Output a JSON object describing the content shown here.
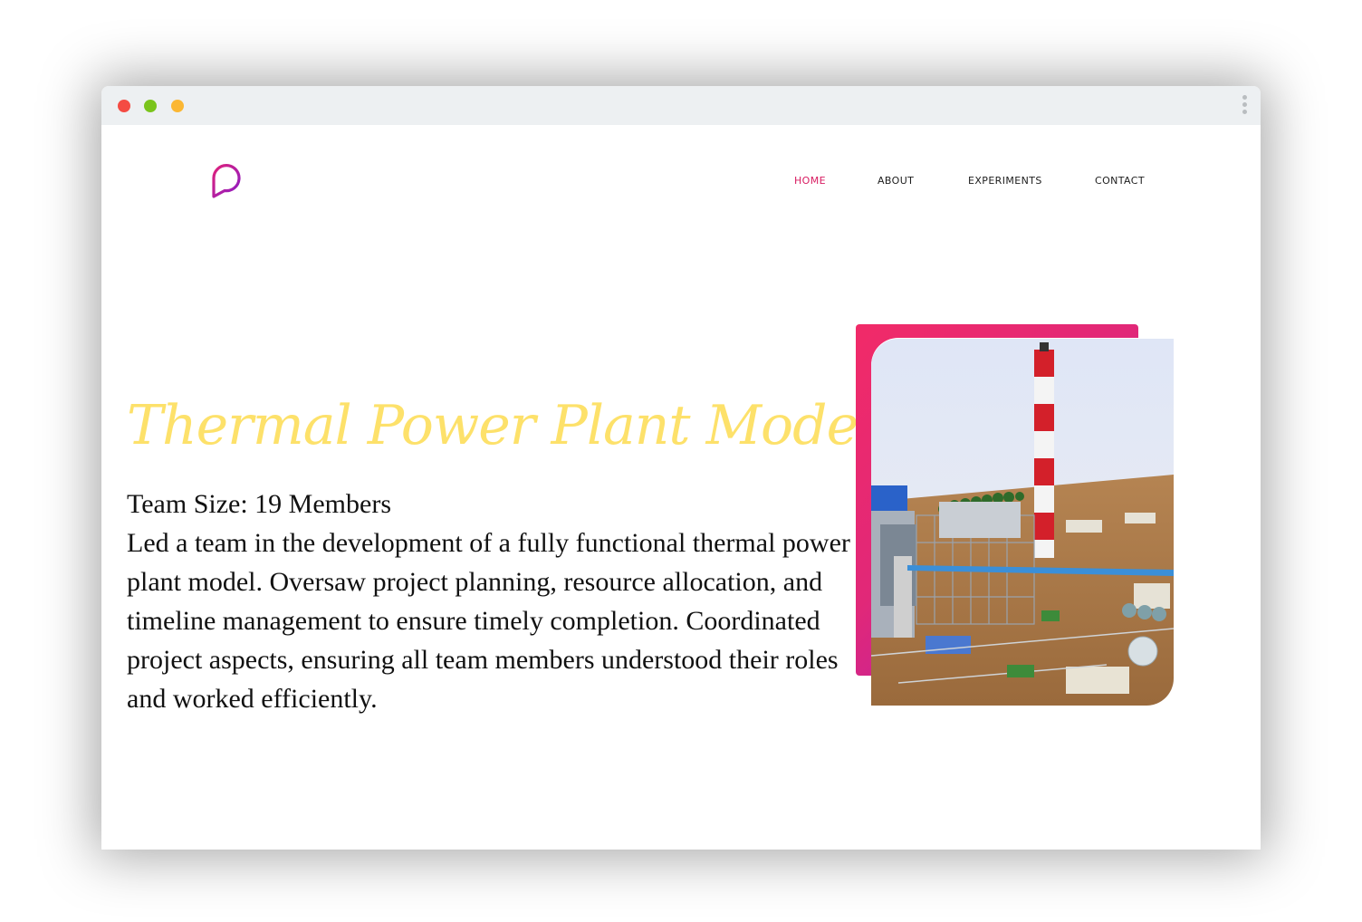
{
  "nav": {
    "items": [
      {
        "label": "HOME",
        "active": true
      },
      {
        "label": "ABOUT",
        "active": false
      },
      {
        "label": "EXPERIMENTS",
        "active": false
      },
      {
        "label": "CONTACT",
        "active": false
      }
    ]
  },
  "hero": {
    "title": "Thermal Power Plant Model",
    "team_size": "Team Size: 19 Members",
    "description": "Led a team in the development of a fully functional thermal power plant model.  Oversaw project planning, resource allocation, and timeline management to ensure timely completion.  Coordinated project aspects, ensuring all team members understood their roles and worked efficiently."
  },
  "colors": {
    "accent": "#d81b60",
    "title": "#fde16a",
    "frame_start": "#f12a68",
    "frame_end": "#a61bbd"
  },
  "icons": {
    "logo": "chat-bubble-logo-icon",
    "window_menu": "kebab-menu-icon"
  }
}
